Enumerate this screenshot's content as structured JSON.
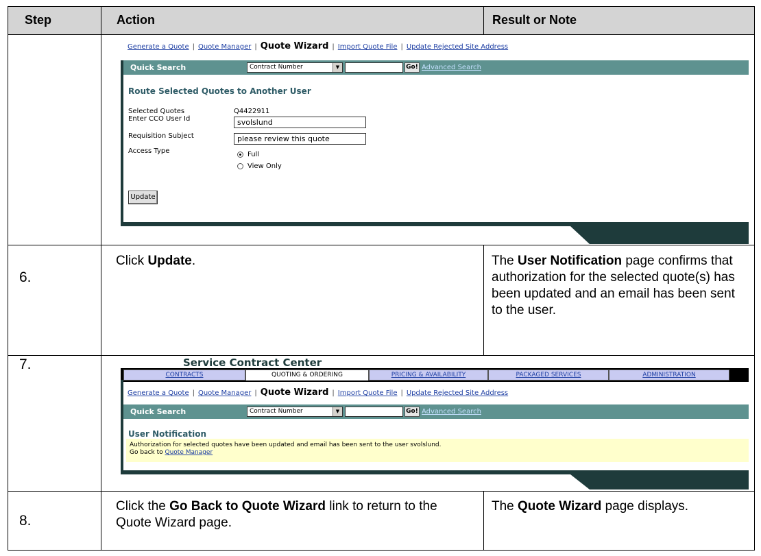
{
  "table": {
    "headers": {
      "step": "Step",
      "action": "Action",
      "result": "Result or Note"
    }
  },
  "screen1": {
    "nav": {
      "generate": "Generate a Quote",
      "manager": "Quote Manager",
      "wizard": "Quote Wizard",
      "import": "Import Quote File",
      "update_rejected": "Update Rejected Site Address"
    },
    "quick_search": {
      "label": "Quick Search",
      "select_value": "Contract Number",
      "go": "Go!",
      "advanced": "Advanced Search"
    },
    "title": "Route Selected Quotes to Another User",
    "form": {
      "selected_quotes_label": "Selected Quotes",
      "selected_quotes_value": "Q4422911",
      "cco_label": "Enter CCO User Id",
      "cco_value": "svolslund",
      "subject_label": "Requisition Subject",
      "subject_value": "please review this quote",
      "access_label": "Access Type",
      "access_full": "Full",
      "access_view": "View Only",
      "update_button": "Update"
    }
  },
  "row6": {
    "step": "6.",
    "action_pre": "Click ",
    "action_bold": "Update",
    "action_post": ".",
    "result_pre": "The ",
    "result_bold": "User Notification",
    "result_post": " page confirms that authorization for the selected quote(s) has been updated and an email has been sent to the user."
  },
  "row7": {
    "step": "7.",
    "screen2": {
      "app_title": "Service Contract Center",
      "tabs": [
        "CONTRACTS",
        "QUOTING & ORDERING",
        "PRICING & AVAILABILITY",
        "PACKAGED SERVICES",
        "ADMINISTRATION"
      ],
      "nav": {
        "generate": "Generate a Quote",
        "manager": "Quote Manager",
        "wizard": "Quote Wizard",
        "import": "Import Quote File",
        "update_rejected": "Update Rejected Site Address"
      },
      "quick_search": {
        "label": "Quick Search",
        "select_value": "Contract Number",
        "go": "Go!",
        "advanced": "Advanced Search"
      },
      "title": "User Notification",
      "message": "Authorization for selected quotes have been updated and email has been sent to the user svolslund.",
      "go_back_prefix": "Go back to ",
      "go_back_link": "Quote Manager"
    }
  },
  "row8": {
    "step": "8.",
    "action_pre": "Click the ",
    "action_bold": "Go Back to Quote Wizard",
    "action_post": " link to return to the Quote Wizard page.",
    "result_pre": "The ",
    "result_bold": "Quote Wizard",
    "result_post": " page displays."
  }
}
